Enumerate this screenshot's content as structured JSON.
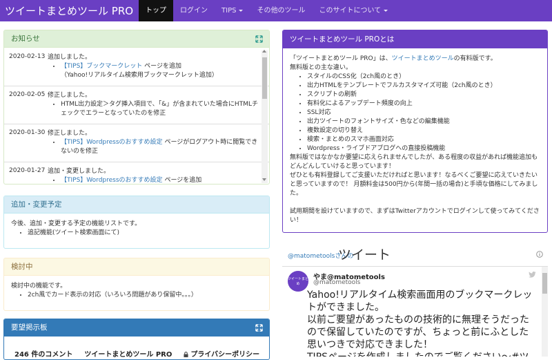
{
  "navbar": {
    "brand": "ツイートまとめツール PRO",
    "items": [
      {
        "label": "トップ",
        "active": true,
        "dropdown": false
      },
      {
        "label": "ログイン",
        "active": false,
        "dropdown": false
      },
      {
        "label": "TIPS",
        "active": false,
        "dropdown": true
      },
      {
        "label": "その他のツール",
        "active": false,
        "dropdown": false
      },
      {
        "label": "このサイトについて",
        "active": false,
        "dropdown": true
      }
    ]
  },
  "news": {
    "title": "お知らせ",
    "entries": [
      {
        "date": "2020-02-13",
        "summary": "追加しました。",
        "link": "【TIPS】ブックマークレット",
        "rest": "ページを追加",
        "sub": "（Yahoo!リアルタイム検索用ブックマークレット追加）"
      },
      {
        "date": "2020-02-05",
        "summary": "修正しました。",
        "link": "",
        "rest": "HTML出力設定＞タグ挿入項目で、「&」が含まれていた場合にHTMLチェックでエラーとなっていたのを修正",
        "sub": ""
      },
      {
        "date": "2020-01-30",
        "summary": "修正しました。",
        "link": "【TIPS】Wordpressのおすすめ設定",
        "rest": "ページがログアウト時に閲覧できないのを修正",
        "sub": ""
      },
      {
        "date": "2020-01-27",
        "summary": "追加・変更しました。",
        "link": "【TIPS】Wordpressのおすすめ設定",
        "rest": "ページを追加",
        "sub": ""
      }
    ]
  },
  "plan": {
    "title": "追加・変更予定",
    "intro": "今後、追加・変更する予定の機能リストです。",
    "items": [
      "追記機能(ツイート検索画面にて)"
    ]
  },
  "review": {
    "title": "検討中",
    "intro": "検討中の機能です。",
    "items": [
      "2ch風でカード表示の対応（いろいろ問題があり保留中。。。）"
    ]
  },
  "board": {
    "title": "要望掲示板",
    "comments": "246 件のコメント",
    "site": "ツイートまとめツール PRO",
    "privacy": "プライバシーポリシー"
  },
  "about": {
    "title": "ツイートまとめツール PROとは",
    "intro_pre": "「ツイートまとめツール PRO」は、",
    "intro_link": "ツイートまとめツール",
    "intro_post": "の有料版です。",
    "diff_label": "無料版との主な違い。",
    "features": [
      "スタイルのCSS化（2ch風のとき）",
      "出力HTMLをテンプレートでフルカスタマイズ可能（2ch風のとき）",
      "スクリプトの刷新",
      "有料化によるアップデート頻度の向上",
      "SSL対応",
      "出力ツイートのフォントサイズ・色などの編集機能",
      "複数設定の切り替え",
      "検索・まとめのスマホ画面対応",
      "Wordpress・ライブドアブログへの直接投稿機能"
    ],
    "para1": "無料版ではなかなか要望に応えられませんでしたが、ある程度の収益があれば機能追加もどんどんしていけると思っています！",
    "para2": "ぜひとも有料登録してご支援いただければと思います！なるべくご要望に応えていきたいと思っていますので！ 月額料金は500円から(年間一括の場合)と手頃な価格にしてみました。",
    "para3": "試用期間を設けていますので、まずはTwitterアカウントでログインして使ってみてください！"
  },
  "tweets": {
    "handle": "@matometoolsさんの",
    "title": "ツイート",
    "author_name": "やま@matometools",
    "author_handle": "@matometools",
    "avatar_text": "ツイートまとめ",
    "lines": [
      "Yahoo!リアルタイム検索画面用のブックマークレットができました。",
      "以前ご要望があったものの技術的に無理そうだったので保留していたのですが、ちょっと前にふとした思いつきで対応できました！",
      "TIPSページを作成しましたのでご覧ください〜#ツイー"
    ]
  }
}
